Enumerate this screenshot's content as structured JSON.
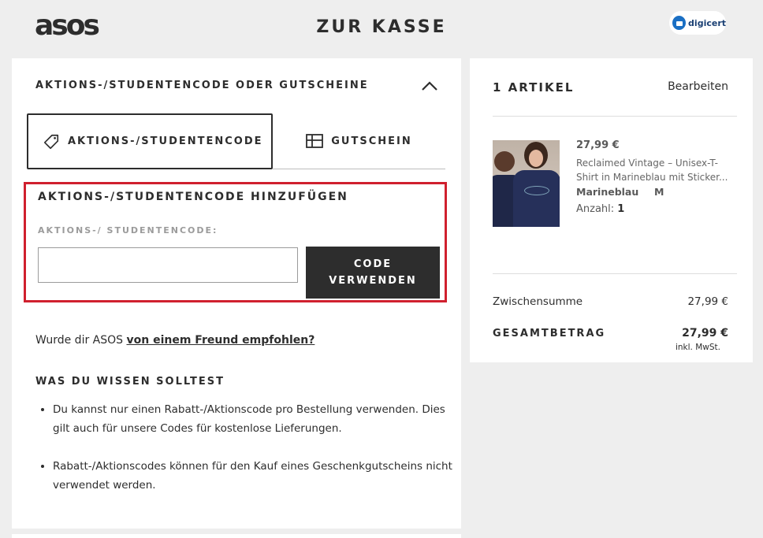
{
  "header": {
    "logo": "asos",
    "title": "ZUR KASSE",
    "seal_text": "digicert"
  },
  "promo": {
    "section_heading": "AKTIONS-/STUDENTENCODE ODER GUTSCHEINE",
    "tab_promo": "AKTIONS-/STUDENTENCODE",
    "tab_voucher": "GUTSCHEIN",
    "add_heading": "AKTIONS-/STUDENTENCODE HINZUFÜGEN",
    "field_label": "AKTIONS-/ STUDENTENCODE:",
    "input_value": "",
    "apply_line1": "CODE",
    "apply_line2": "VERWENDEN"
  },
  "referral": {
    "text": "Wurde dir ASOS ",
    "link": "von einem Freund empfohlen?"
  },
  "info": {
    "heading": "WAS DU WISSEN SOLLTEST",
    "bullets": [
      "Du kannst nur einen Rabatt-/Aktionscode pro Bestellung verwenden. Dies gilt auch für unsere Codes für kostenlose Lieferungen.",
      "Rabatt-/Aktionscodes können für den Kauf eines Geschenkgutscheins nicht verwendet werden."
    ]
  },
  "bag": {
    "count": "1 ARTIKEL",
    "edit": "Bearbeiten",
    "item": {
      "price": "27,99 €",
      "name": "Reclaimed Vintage – Unisex-T-Shirt in Marineblau mit Sticker...",
      "color": "Marineblau",
      "size": "M",
      "qty_label": "Anzahl: ",
      "qty": "1"
    },
    "subtotal_label": "Zwischensumme",
    "subtotal_value": "27,99 €",
    "total_label": "GESAMTBETRAG",
    "total_value": "27,99 €",
    "vat_note": "inkl. MwSt."
  },
  "colors": {
    "highlight": "#d0202e",
    "button": "#2d2d2d",
    "background": "#eeeeee"
  }
}
